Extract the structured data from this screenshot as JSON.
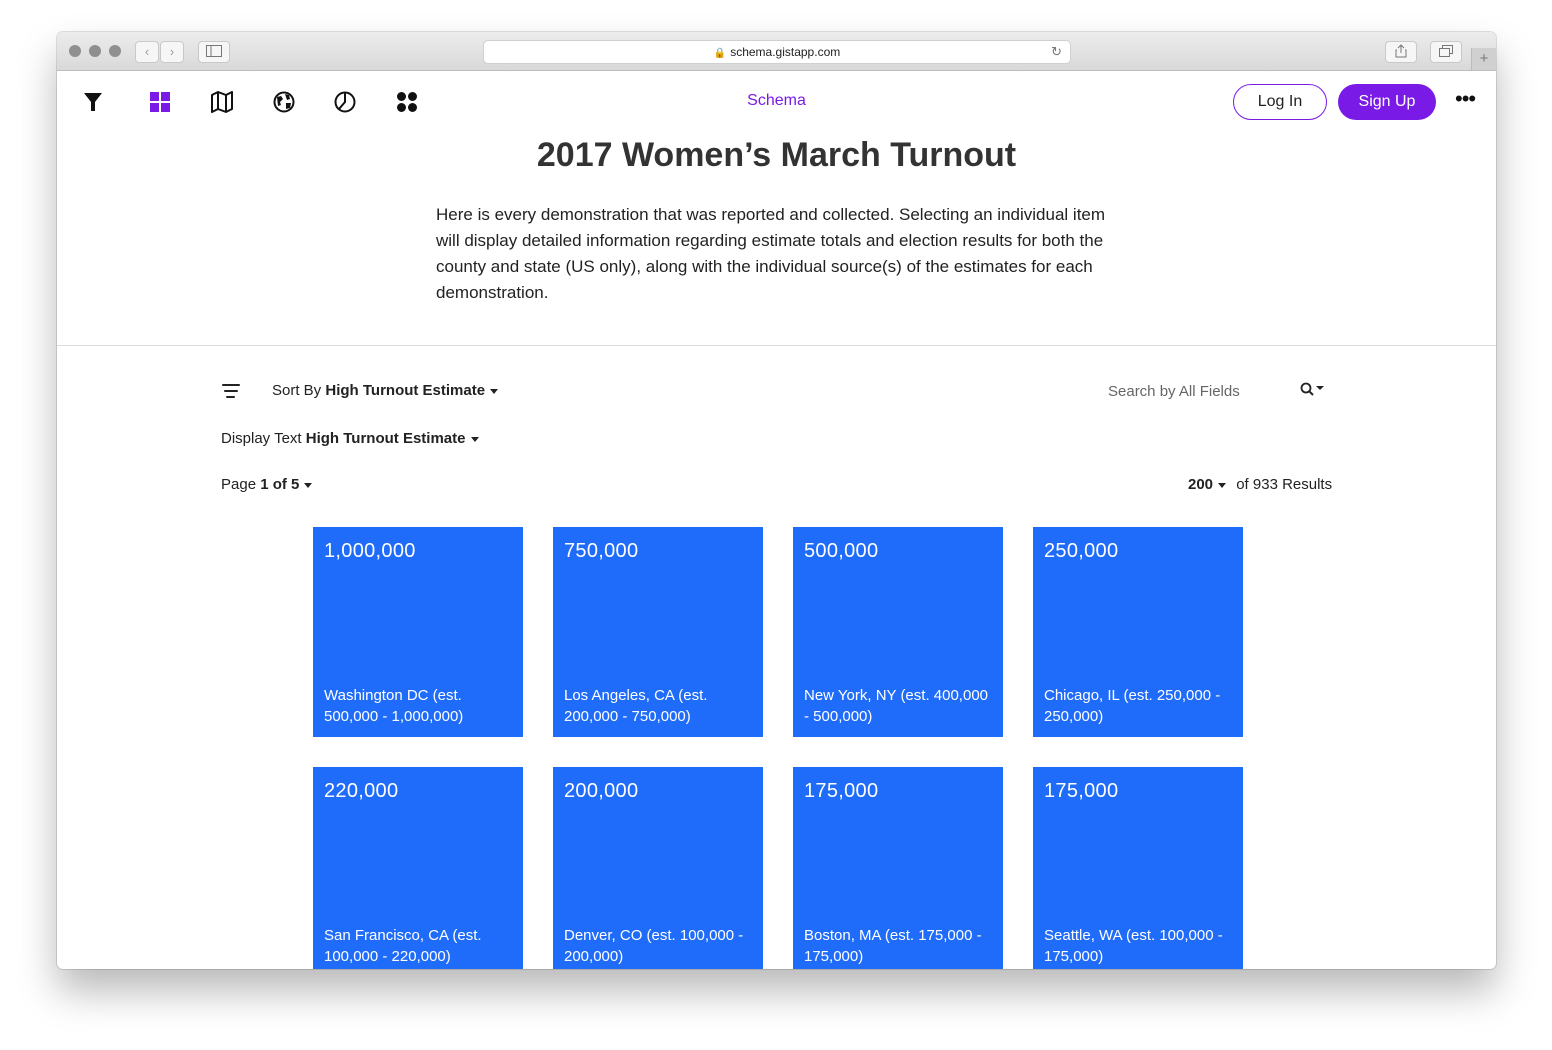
{
  "browser": {
    "url": "schema.gistapp.com"
  },
  "header": {
    "brand": "Schema",
    "login_label": "Log In",
    "signup_label": "Sign Up",
    "tool_icons": [
      "filter-icon",
      "grid-view-icon",
      "map-icon",
      "globe-icon",
      "pie-chart-icon",
      "cluster-icon"
    ],
    "accent_color": "#7a1ae6"
  },
  "page": {
    "title": "2017 Women’s March Turnout",
    "description": "Here is every demonstration that was reported and collected. Selecting an individual item will display detailed information regarding estimate totals and election results for both the county and state (US only), along with the individual source(s) of the estimates for each demonstration."
  },
  "controls": {
    "sort_prefix": "Sort By",
    "sort_value": "High Turnout Estimate",
    "display_prefix": "Display Text",
    "display_value": "High Turnout Estimate",
    "page_prefix": "Page",
    "page_value": "1 of 5",
    "per_page": "200",
    "results_text": "of 933 Results",
    "search_placeholder": "Search by All Fields"
  },
  "cards": [
    {
      "value": "1,000,000",
      "label": "Washington DC (est. 500,000 - 1,000,000)"
    },
    {
      "value": "750,000",
      "label": "Los Angeles, CA (est. 200,000 - 750,000)"
    },
    {
      "value": "500,000",
      "label": "New York, NY (est. 400,000 - 500,000)"
    },
    {
      "value": "250,000",
      "label": "Chicago, IL (est. 250,000 - 250,000)"
    },
    {
      "value": "220,000",
      "label": "San Francisco, CA (est. 100,000 - 220,000)"
    },
    {
      "value": "200,000",
      "label": "Denver, CO (est. 100,000 - 200,000)"
    },
    {
      "value": "175,000",
      "label": "Boston, MA (est. 175,000 - 175,000)"
    },
    {
      "value": "175,000",
      "label": "Seattle, WA (est. 100,000 - 175,000)"
    }
  ],
  "colors": {
    "card_background": "#1f6cfb"
  }
}
